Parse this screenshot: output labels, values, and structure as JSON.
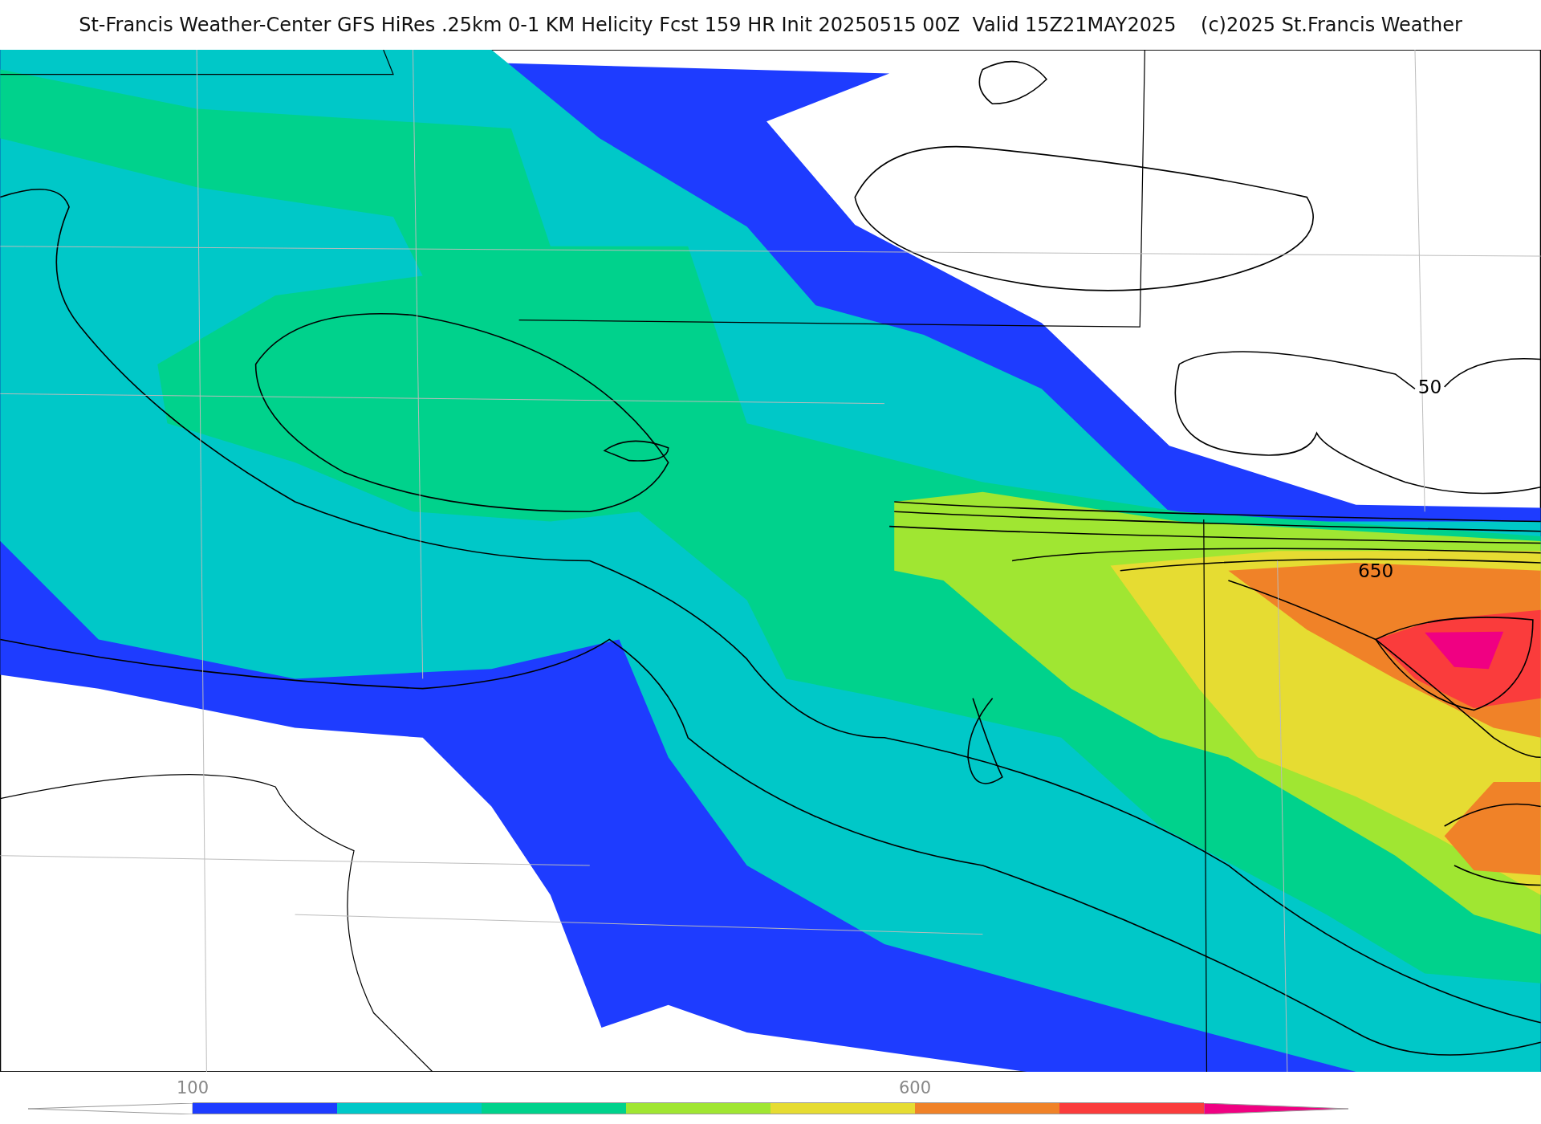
{
  "title": "St-Francis Weather-Center GFS HiRes .25km 0-1 KM Helicity Fcst 159 HR Init 20250515 00Z  Valid 15Z21MAY2025    (c)2025 St.Francis Weather",
  "map": {
    "contour_labels": [
      "50",
      "650"
    ]
  },
  "colorbar": [
    {
      "kind": "tail-left",
      "color": "#ffffff"
    },
    {
      "kind": "box",
      "color": "#1e3cff",
      "label": "100"
    },
    {
      "kind": "box",
      "color": "#00c8c8"
    },
    {
      "kind": "box",
      "color": "#00d28c"
    },
    {
      "kind": "box",
      "color": "#a0e632"
    },
    {
      "kind": "box",
      "color": "#e6dc32"
    },
    {
      "kind": "box",
      "color": "#f08228",
      "label": "600"
    },
    {
      "kind": "box",
      "color": "#fa3c3c"
    },
    {
      "kind": "tail-right",
      "color": "#f00082"
    }
  ]
}
